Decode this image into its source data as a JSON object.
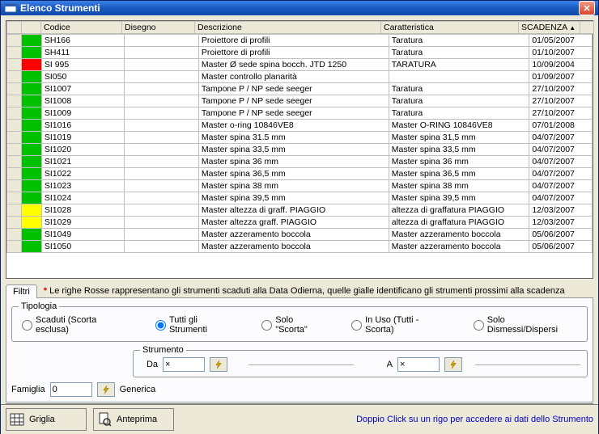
{
  "window": {
    "title": "Elenco Strumenti"
  },
  "grid": {
    "headers": {
      "codice": "Codice",
      "disegno": "Disegno",
      "descrizione": "Descrizione",
      "caratteristica": "Caratteristica",
      "scadenza": "SCADENZA"
    },
    "rows": [
      {
        "status": "green",
        "codice": "SH166",
        "disegno": "",
        "descrizione": "Proiettore di profili",
        "caratteristica": "Taratura",
        "scadenza": "01/05/2007"
      },
      {
        "status": "green",
        "codice": "SH411",
        "disegno": "",
        "descrizione": "Proiettore di profili",
        "caratteristica": "Taratura",
        "scadenza": "01/10/2007"
      },
      {
        "status": "red",
        "codice": "SI 995",
        "disegno": "",
        "descrizione": "Master Ø sede spina bocch. JTD 1250",
        "caratteristica": "TARATURA",
        "scadenza": "10/09/2004"
      },
      {
        "status": "green",
        "codice": "SI050",
        "disegno": "",
        "descrizione": "Master controllo planarità",
        "caratteristica": "",
        "scadenza": "01/09/2007"
      },
      {
        "status": "green",
        "codice": "SI1007",
        "disegno": "",
        "descrizione": "Tampone P / NP sede seeger",
        "caratteristica": "Taratura",
        "scadenza": "27/10/2007"
      },
      {
        "status": "green",
        "codice": "SI1008",
        "disegno": "",
        "descrizione": "Tampone P / NP sede seeger",
        "caratteristica": "Taratura",
        "scadenza": "27/10/2007"
      },
      {
        "status": "green",
        "codice": "SI1009",
        "disegno": "",
        "descrizione": "Tampone P / NP sede seeger",
        "caratteristica": "Taratura",
        "scadenza": "27/10/2007"
      },
      {
        "status": "green",
        "codice": "SI1016",
        "disegno": "",
        "descrizione": "Master o-ring 10846VE8",
        "caratteristica": "Master O-RING 10846VE8",
        "scadenza": "07/01/2008"
      },
      {
        "status": "green",
        "codice": "SI1019",
        "disegno": "",
        "descrizione": "Master spina 31.5 mm",
        "caratteristica": "Master spina 31,5 mm",
        "scadenza": "04/07/2007"
      },
      {
        "status": "green",
        "codice": "SI1020",
        "disegno": "",
        "descrizione": "Master spina 33,5 mm",
        "caratteristica": "Master spina 33,5 mm",
        "scadenza": "04/07/2007"
      },
      {
        "status": "green",
        "codice": "SI1021",
        "disegno": "",
        "descrizione": "Master spina 36 mm",
        "caratteristica": "Master spina 36 mm",
        "scadenza": "04/07/2007"
      },
      {
        "status": "green",
        "codice": "SI1022",
        "disegno": "",
        "descrizione": "Master spina 36,5 mm",
        "caratteristica": "Master spina 36,5 mm",
        "scadenza": "04/07/2007"
      },
      {
        "status": "green",
        "codice": "SI1023",
        "disegno": "",
        "descrizione": "Master spina 38 mm",
        "caratteristica": "Master spina 38 mm",
        "scadenza": "04/07/2007"
      },
      {
        "status": "green",
        "codice": "SI1024",
        "disegno": "",
        "descrizione": "Master spina 39,5 mm",
        "caratteristica": "Master spina 39,5 mm",
        "scadenza": "04/07/2007"
      },
      {
        "status": "yellow",
        "codice": "SI1028",
        "disegno": "",
        "descrizione": "Master altezza di graff. PIAGGIO",
        "caratteristica": "altezza di graffatura PIAGGIO",
        "scadenza": "12/03/2007"
      },
      {
        "status": "yellow",
        "codice": "SI1029",
        "disegno": "",
        "descrizione": "Master altezza graff. PIAGGIO",
        "caratteristica": "altezza di graffatura PIAGGIO",
        "scadenza": "12/03/2007"
      },
      {
        "status": "green",
        "codice": "SI1049",
        "disegno": "",
        "descrizione": "Master azzeramento boccola",
        "caratteristica": "Master azzeramento boccola",
        "scadenza": "05/06/2007"
      },
      {
        "status": "green",
        "codice": "SI1050",
        "disegno": "",
        "descrizione": "Master azzeramento boccola",
        "caratteristica": "Master azzeramento boccola",
        "scadenza": "05/06/2007"
      }
    ]
  },
  "tabs": {
    "filtri": "Filtri"
  },
  "legend": "Le righe Rosse rappresentano gli strumenti scaduti alla Data Odierna, quelle gialle identificano gli strumenti prossimi alla scadenza",
  "tipologia": {
    "legend": "Tipologia",
    "options": {
      "scaduti": "Scaduti (Scorta esclusa)",
      "tutti": "Tutti gli Strumenti",
      "scorta": "Solo \"Scorta\"",
      "inuso": "In Uso (Tutti - Scorta)",
      "dismessi": "Solo Dismessi/Dispersi"
    },
    "selected": "tutti"
  },
  "strumento": {
    "legend": "Strumento",
    "da_label": "Da",
    "da_value": "×",
    "a_label": "A",
    "a_value": "×"
  },
  "famiglia": {
    "label": "Famiglia",
    "value": "0",
    "desc": "Generica"
  },
  "bottom": {
    "griglia": "Griglia",
    "anteprima": "Anteprima",
    "hint": "Doppio Click su un rigo per accedere ai dati dello Strumento"
  }
}
